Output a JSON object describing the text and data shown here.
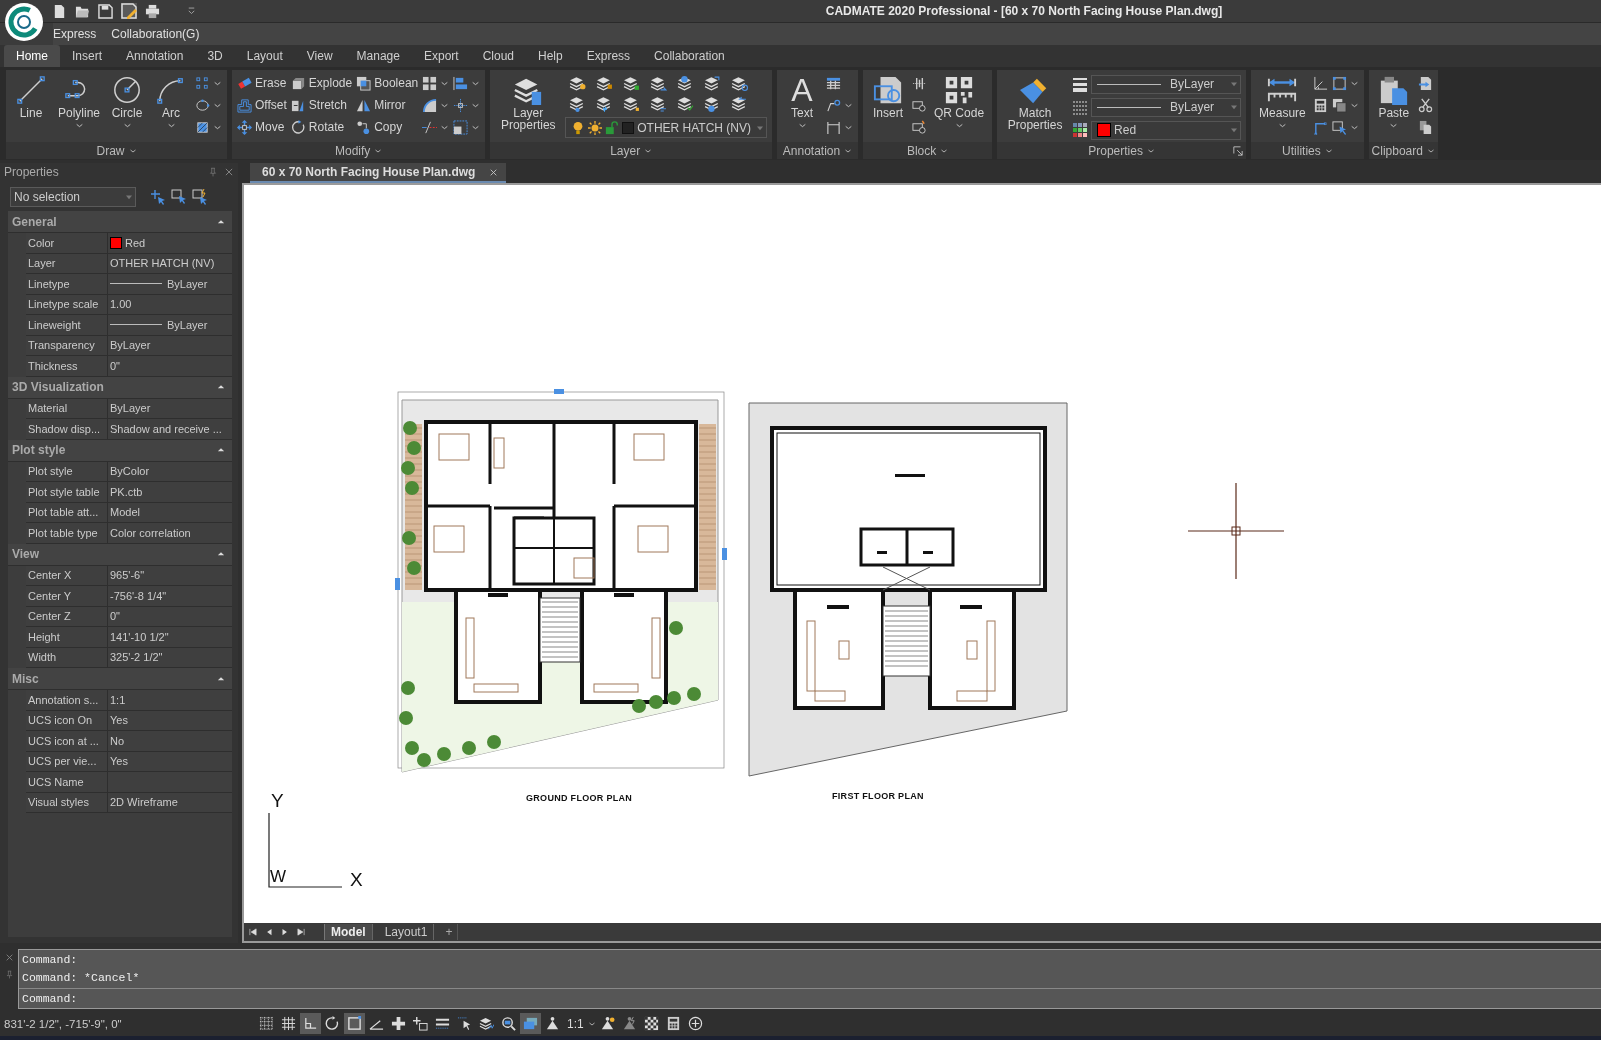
{
  "window": {
    "title": "CADMATE 2020 Professional - [60 x 70 North Facing House Plan.dwg]",
    "menu": [
      "Express",
      "Collaboration(G)"
    ]
  },
  "ribbon": {
    "tabs": [
      {
        "label": "Home",
        "selected": true
      },
      {
        "label": "Insert",
        "selected": false
      },
      {
        "label": "Annotation",
        "selected": false
      },
      {
        "label": "3D",
        "selected": false
      },
      {
        "label": "Layout",
        "selected": false
      },
      {
        "label": "View",
        "selected": false
      },
      {
        "label": "Manage",
        "selected": false
      },
      {
        "label": "Export",
        "selected": false
      },
      {
        "label": "Cloud",
        "selected": false
      },
      {
        "label": "Help",
        "selected": false
      },
      {
        "label": "Express",
        "selected": false
      },
      {
        "label": "Collaboration",
        "selected": false
      }
    ],
    "panels": [
      {
        "title": "Draw",
        "launcher": false,
        "columns": [
          {
            "items": [
              {
                "kind": "large",
                "label": "Line",
                "menu": false
              }
            ]
          },
          {
            "items": [
              {
                "kind": "large",
                "label": "Polyline",
                "menu": true
              }
            ]
          },
          {
            "items": [
              {
                "kind": "large",
                "label": "Circle",
                "menu": true
              }
            ]
          },
          {
            "items": [
              {
                "kind": "large",
                "label": "Arc",
                "menu": true
              }
            ]
          },
          {
            "items": [
              {
                "kind": "icon",
                "menu": true
              },
              {
                "kind": "icon",
                "menu": true
              },
              {
                "kind": "icon",
                "menu": true
              }
            ]
          }
        ]
      },
      {
        "title": "Modify",
        "launcher": false,
        "columns": [
          {
            "items": [
              {
                "kind": "small",
                "label": "Erase",
                "menu": false
              },
              {
                "kind": "small",
                "label": "Offset",
                "menu": false
              },
              {
                "kind": "small",
                "label": "Move",
                "menu": false
              }
            ]
          },
          {
            "items": [
              {
                "kind": "small",
                "label": "Explode",
                "menu": false
              },
              {
                "kind": "small",
                "label": "Stretch",
                "menu": false
              },
              {
                "kind": "small",
                "label": "Rotate",
                "menu": false
              }
            ]
          },
          {
            "items": [
              {
                "kind": "small",
                "label": "Boolean",
                "menu": false
              },
              {
                "kind": "small",
                "label": "Mirror",
                "menu": false
              },
              {
                "kind": "small",
                "label": "Copy",
                "menu": false
              }
            ]
          },
          {
            "items": [
              {
                "kind": "icon",
                "menu": true
              },
              {
                "kind": "icon",
                "menu": true
              },
              {
                "kind": "icon",
                "menu": true
              }
            ]
          },
          {
            "items": [
              {
                "kind": "icon",
                "menu": true
              },
              {
                "kind": "icon",
                "menu": true
              },
              {
                "kind": "icon",
                "menu": true
              }
            ]
          }
        ]
      },
      {
        "title": "Layer",
        "launcher": false,
        "columns": [
          {
            "items": [
              {
                "kind": "large",
                "label": "Layer Properties",
                "menu": false
              }
            ]
          },
          {
            "items": [
              {
                "kind": "layer-block",
                "value": "OTHER HATCH (NV)"
              }
            ]
          }
        ]
      },
      {
        "title": "Annotation",
        "launcher": false,
        "columns": [
          {
            "items": [
              {
                "kind": "large",
                "label": "Text",
                "glyph": "A",
                "menu": true
              }
            ]
          },
          {
            "items": [
              {
                "kind": "icon",
                "menu": false
              },
              {
                "kind": "icon",
                "menu": true
              },
              {
                "kind": "icon",
                "menu": true
              }
            ]
          }
        ]
      },
      {
        "title": "Block",
        "launcher": false,
        "columns": [
          {
            "items": [
              {
                "kind": "large",
                "label": "Insert",
                "menu": false
              }
            ]
          },
          {
            "items": [
              {
                "kind": "icon",
                "menu": false
              },
              {
                "kind": "icon",
                "menu": false
              },
              {
                "kind": "icon",
                "menu": false
              }
            ]
          },
          {
            "items": [
              {
                "kind": "large",
                "label": "QR Code",
                "menu": true
              }
            ]
          }
        ]
      },
      {
        "title": "Properties",
        "launcher": true,
        "columns": [
          {
            "items": [
              {
                "kind": "large",
                "label": "Match Properties",
                "menu": false
              }
            ]
          },
          {
            "items": [
              {
                "kind": "combos",
                "rows": [
                  {
                    "kind": "line",
                    "value": "ByLayer"
                  },
                  {
                    "kind": "line",
                    "value": "ByLayer"
                  },
                  {
                    "kind": "color",
                    "value": "Red",
                    "color": "#ff0000"
                  }
                ]
              }
            ]
          }
        ]
      },
      {
        "title": "Utilities",
        "launcher": false,
        "columns": [
          {
            "items": [
              {
                "kind": "large",
                "label": "Measure",
                "menu": true
              }
            ]
          },
          {
            "items": [
              {
                "kind": "icon",
                "menu": false
              },
              {
                "kind": "icon",
                "menu": false
              },
              {
                "kind": "icon",
                "menu": false
              }
            ]
          },
          {
            "items": [
              {
                "kind": "icon",
                "menu": true
              },
              {
                "kind": "icon",
                "menu": true
              },
              {
                "kind": "icon",
                "menu": true
              }
            ]
          }
        ]
      },
      {
        "title": "Clipboard",
        "launcher": false,
        "columns": [
          {
            "items": [
              {
                "kind": "large",
                "label": "Paste",
                "menu": true
              }
            ]
          },
          {
            "items": [
              {
                "kind": "icon",
                "menu": false
              },
              {
                "kind": "icon",
                "menu": false
              },
              {
                "kind": "icon",
                "menu": false
              }
            ]
          }
        ]
      }
    ]
  },
  "properties_panel": {
    "title": "Properties",
    "selection": "No selection",
    "sections": [
      {
        "title": "General",
        "expanded": true,
        "rows": [
          {
            "label": "Color",
            "value": "Red",
            "kind": "color",
            "color": "#ff0000"
          },
          {
            "label": "Layer",
            "value": "OTHER HATCH (NV)",
            "kind": "text"
          },
          {
            "label": "Linetype",
            "value": "ByLayer",
            "kind": "line"
          },
          {
            "label": "Linetype scale",
            "value": "1.00",
            "kind": "text"
          },
          {
            "label": "Lineweight",
            "value": "ByLayer",
            "kind": "line"
          },
          {
            "label": "Transparency",
            "value": "ByLayer",
            "kind": "text"
          },
          {
            "label": "Thickness",
            "value": "0\"",
            "kind": "text"
          }
        ]
      },
      {
        "title": "3D Visualization",
        "expanded": true,
        "rows": [
          {
            "label": "Material",
            "value": "ByLayer",
            "kind": "text"
          },
          {
            "label": "Shadow disp...",
            "value": "Shadow and receive ...",
            "kind": "text"
          }
        ]
      },
      {
        "title": "Plot style",
        "expanded": true,
        "rows": [
          {
            "label": "Plot style",
            "value": "ByColor",
            "kind": "text"
          },
          {
            "label": "Plot style table",
            "value": "PK.ctb",
            "kind": "text"
          },
          {
            "label": "Plot table att...",
            "value": "Model",
            "kind": "text"
          },
          {
            "label": "Plot table type",
            "value": "Color correlation",
            "kind": "text"
          }
        ]
      },
      {
        "title": "View",
        "expanded": true,
        "rows": [
          {
            "label": "Center X",
            "value": "965'-6\"",
            "kind": "text"
          },
          {
            "label": "Center Y",
            "value": "-756'-8 1/4\"",
            "kind": "text"
          },
          {
            "label": "Center Z",
            "value": "0\"",
            "kind": "text"
          },
          {
            "label": "Height",
            "value": "141'-10 1/2\"",
            "kind": "text"
          },
          {
            "label": "Width",
            "value": "325'-2 1/2\"",
            "kind": "text"
          }
        ]
      },
      {
        "title": "Misc",
        "expanded": true,
        "rows": [
          {
            "label": "Annotation s...",
            "value": "1:1",
            "kind": "text"
          },
          {
            "label": "UCS icon On",
            "value": "Yes",
            "kind": "text"
          },
          {
            "label": "UCS icon at ...",
            "value": "No",
            "kind": "text"
          },
          {
            "label": "UCS per vie...",
            "value": "Yes",
            "kind": "text"
          },
          {
            "label": "UCS Name",
            "kind": "text"
          },
          {
            "label": "Visual styles",
            "value": "2D Wireframe",
            "kind": "text"
          }
        ]
      }
    ]
  },
  "document": {
    "tab": "60 x 70 North Facing House Plan.dwg",
    "plans": [
      {
        "label": "GROUND FLOOR PLAN",
        "kind": "ground",
        "selected": true
      },
      {
        "label": "FIRST FLOOR PLAN",
        "kind": "first",
        "selected": false
      }
    ],
    "ucs": {
      "y": "Y",
      "origin": "W",
      "x": "X"
    },
    "layout_tabs": [
      {
        "label": "Model",
        "kind": "model",
        "selected": true
      },
      {
        "label": "Layout1",
        "kind": "layout",
        "selected": false
      },
      {
        "label": "+",
        "kind": "new",
        "selected": false
      }
    ]
  },
  "command": {
    "history": [
      "Command:",
      "Command: *Cancel*"
    ],
    "prompt": "Command:"
  },
  "status_bar": {
    "coordinates": "831'-2 1/2\", -715'-9\", 0\"",
    "toggles": [
      {
        "on": false
      },
      {
        "on": false
      },
      {
        "on": true
      },
      {
        "on": false
      },
      {
        "on": true
      },
      {
        "on": false
      },
      {
        "on": false
      },
      {
        "on": false
      },
      {
        "on": false
      },
      {
        "on": false
      },
      {
        "on": false
      },
      {
        "on": false
      },
      {
        "on": true
      }
    ],
    "annotation_scale": "1:1"
  }
}
